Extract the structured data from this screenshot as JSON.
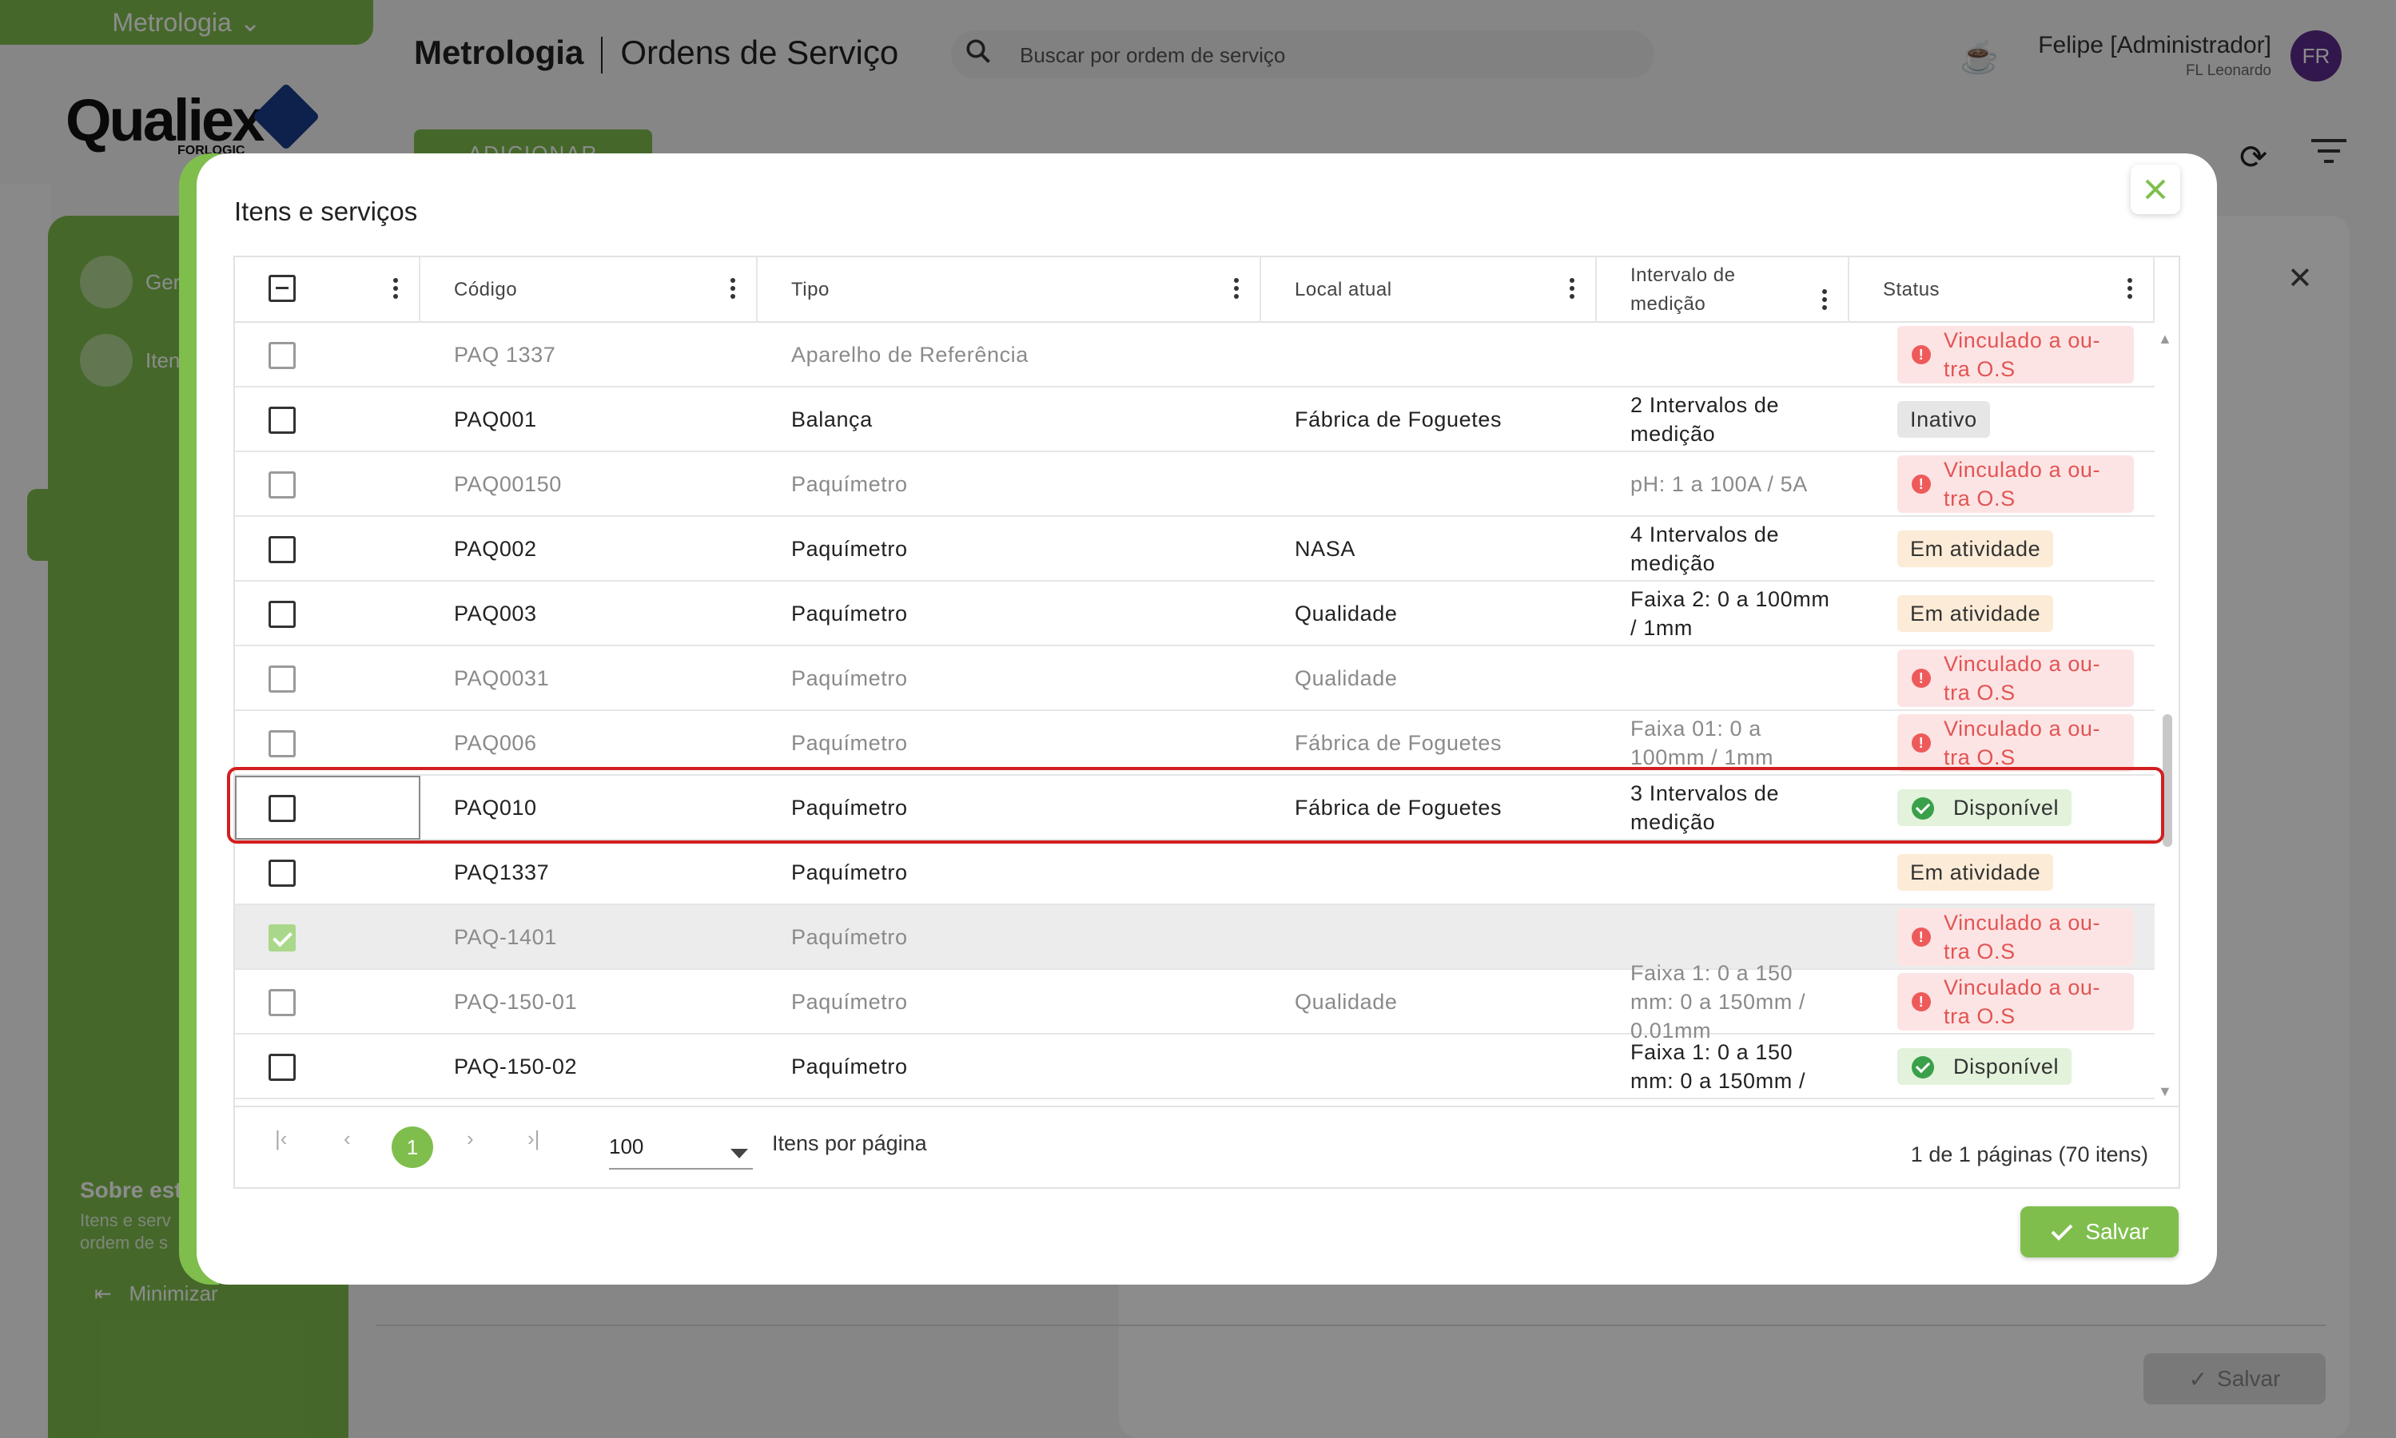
{
  "app": {
    "module_menu": "Metrologia",
    "logo_text": "Qualiex",
    "logo_sub": "FORLOGIC",
    "title_module": "Metrologia",
    "title_page": "Ordens de Serviço",
    "search_placeholder": "Buscar por ordem de serviço",
    "user_name": "Felipe [Administrador]",
    "user_sub": "FL Leonardo",
    "user_initials": "FR",
    "add_button": "ADICIONAR"
  },
  "side_panel": {
    "item1": "Ger",
    "item2": "Iten",
    "about_title": "Sobre esta",
    "about_text_1": "Itens e serv",
    "about_text_2": "ordem de s",
    "minimize": "Minimizar"
  },
  "background_save": "Salvar",
  "modal": {
    "title": "Itens e serviços",
    "columns": [
      "Código",
      "Tipo",
      "Local atual",
      "Intervalo de medição",
      "Status"
    ],
    "rows": [
      {
        "code": "PAQ 1337",
        "type": "Aparelho de Referência",
        "local": "",
        "interval": "",
        "status": "Vinculado a ou-tra O.S",
        "status_kind": "vinculado",
        "dim": true,
        "checked": false
      },
      {
        "code": "PAQ001",
        "type": "Balança",
        "local": "Fábrica de Foguetes",
        "interval": "2 Intervalos de medição",
        "status": "Inativo",
        "status_kind": "inativo",
        "dim": false,
        "checked": false
      },
      {
        "code": "PAQ00150",
        "type": "Paquímetro",
        "local": "",
        "interval": "pH: 1 a 100A / 5A",
        "status": "Vinculado a ou-tra O.S",
        "status_kind": "vinculado",
        "dim": true,
        "checked": false
      },
      {
        "code": "PAQ002",
        "type": "Paquímetro",
        "local": "NASA",
        "interval": "4 Intervalos de medição",
        "status": "Em atividade",
        "status_kind": "atividade",
        "dim": false,
        "checked": false
      },
      {
        "code": "PAQ003",
        "type": "Paquímetro",
        "local": "Qualidade",
        "interval": "Faixa 2: 0 a 100mm / 1mm",
        "status": "Em atividade",
        "status_kind": "atividade",
        "dim": false,
        "checked": false
      },
      {
        "code": "PAQ0031",
        "type": "Paquímetro",
        "local": "Qualidade",
        "interval": "",
        "status": "Vinculado a ou-tra O.S",
        "status_kind": "vinculado",
        "dim": true,
        "checked": false
      },
      {
        "code": "PAQ006",
        "type": "Paquímetro",
        "local": "Fábrica de Foguetes",
        "interval": "Faixa 01: 0 a 100mm / 1mm",
        "status": "Vinculado a ou-tra O.S",
        "status_kind": "vinculado",
        "dim": true,
        "checked": false
      },
      {
        "code": "PAQ010",
        "type": "Paquímetro",
        "local": "Fábrica de Foguetes",
        "interval": "3 Intervalos de medição",
        "status": "Disponível",
        "status_kind": "disponivel",
        "dim": false,
        "checked": false
      },
      {
        "code": "PAQ1337",
        "type": "Paquímetro",
        "local": "",
        "interval": "",
        "status": "Em atividade",
        "status_kind": "atividade",
        "dim": false,
        "checked": false
      },
      {
        "code": "PAQ-1401",
        "type": "Paquímetro",
        "local": "",
        "interval": "",
        "status": "Vinculado a ou-tra O.S",
        "status_kind": "vinculado",
        "dim": true,
        "checked": true
      },
      {
        "code": "PAQ-150-01",
        "type": "Paquímetro",
        "local": "Qualidade",
        "interval": "Faixa 1: 0 a 150 mm: 0 a 150mm / 0.01mm",
        "status": "Vinculado a ou-tra O.S",
        "status_kind": "vinculado",
        "dim": true,
        "checked": false
      },
      {
        "code": "PAQ-150-02",
        "type": "Paquímetro",
        "local": "",
        "interval": "Faixa 1: 0 a 150 mm: 0 a 150mm /",
        "status": "Disponível",
        "status_kind": "disponivel",
        "dim": false,
        "checked": false
      }
    ],
    "pagination": {
      "current_page": "1",
      "per_page": "100",
      "per_page_label": "Itens por página",
      "info": "1 de 1 páginas (70 itens)"
    },
    "save_button": "Salvar"
  },
  "colors": {
    "accent": "#7fbe4d",
    "highlight": "#d21f1f",
    "vinculado_bg": "#fde4e4",
    "disponivel_bg": "#e2f2db",
    "atividade_bg": "#fcecd7"
  }
}
